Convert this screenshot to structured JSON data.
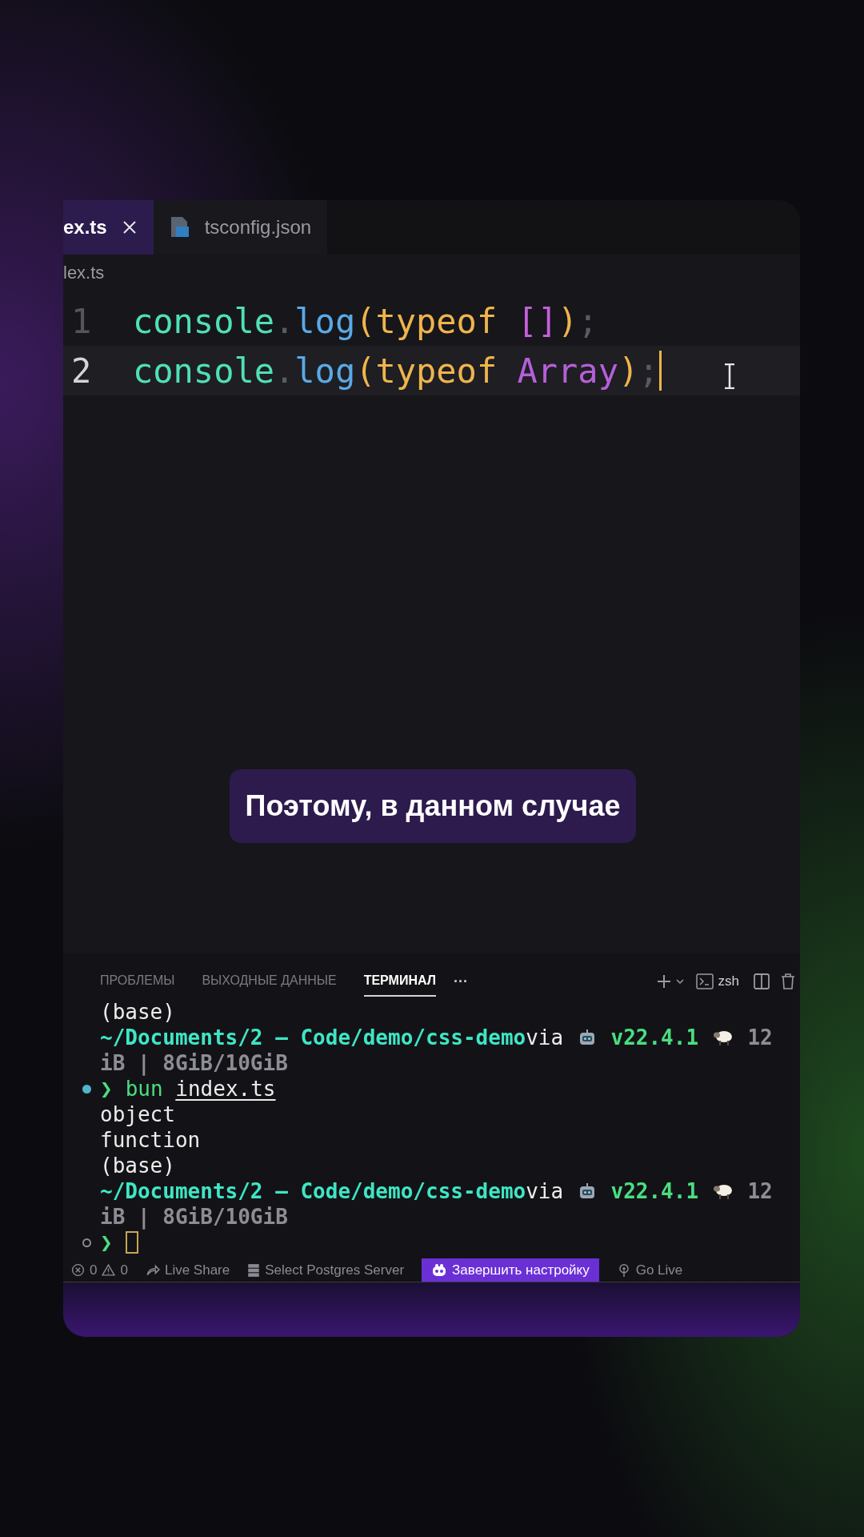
{
  "tabs": [
    {
      "label": "ex.ts",
      "selected": true,
      "closable": true
    },
    {
      "label": "tsconfig.json",
      "selected": false,
      "closable": false
    }
  ],
  "breadcrumb": "lex.ts",
  "code_lines": [
    {
      "number": "1",
      "current": false,
      "tokens": [
        {
          "text": "console",
          "color": "#4fe0b6"
        },
        {
          "text": ".",
          "color": "#5a5a66"
        },
        {
          "text": "log",
          "color": "#5aa9e6"
        },
        {
          "text": "(",
          "color": "#f0b44c"
        },
        {
          "text": "typeof ",
          "color": "#f0b44c"
        },
        {
          "text": "[]",
          "color": "#c55fd9"
        },
        {
          "text": ")",
          "color": "#f0b44c"
        },
        {
          "text": ";",
          "color": "#5a5a66"
        }
      ]
    },
    {
      "number": "2",
      "current": true,
      "tokens": [
        {
          "text": "console",
          "color": "#4fe0b6"
        },
        {
          "text": ".",
          "color": "#5a5a66"
        },
        {
          "text": "log",
          "color": "#5aa9e6"
        },
        {
          "text": "(",
          "color": "#f0b44c"
        },
        {
          "text": "typeof ",
          "color": "#f0b44c"
        },
        {
          "text": "Array",
          "color": "#b65fd9"
        },
        {
          "text": ")",
          "color": "#f0b44c"
        },
        {
          "text": ";",
          "color": "#5a5a66"
        }
      ]
    }
  ],
  "caption": "Поэтому, в данном случае",
  "panel_tabs": [
    {
      "label": "ПРОБЛЕМЫ",
      "selected": false
    },
    {
      "label": "ВЫХОДНЫЕ ДАННЫЕ",
      "selected": false
    },
    {
      "label": "ТЕРМИНАЛ",
      "selected": true
    }
  ],
  "panel_more": "···",
  "shell": "zsh",
  "terminal_lines": [
    {
      "segments": [
        {
          "kind": "plain",
          "text": "(base)"
        }
      ]
    },
    {
      "segments": [
        {
          "kind": "path",
          "text": "~/Documents/2 – Code/demo/css-demo"
        },
        {
          "kind": "plain",
          "text": "via "
        },
        {
          "kind": "robot"
        },
        {
          "kind": "version",
          "text": " v22.4.1 "
        },
        {
          "kind": "sheep"
        },
        {
          "kind": "dim",
          "text": " 12"
        }
      ]
    },
    {
      "segments": [
        {
          "kind": "dim",
          "text": "iB | 8GiB/10GiB"
        }
      ]
    },
    {
      "prompt": {
        "filled": true,
        "symbol": "❯"
      },
      "segments": [
        {
          "kind": "cmd",
          "text": "bun "
        },
        {
          "kind": "arg",
          "text": "index.ts"
        }
      ]
    },
    {
      "segments": [
        {
          "kind": "plain",
          "text": "object"
        }
      ]
    },
    {
      "segments": [
        {
          "kind": "plain",
          "text": "function"
        }
      ]
    },
    {
      "segments": [
        {
          "kind": "plain",
          "text": "(base)"
        }
      ]
    },
    {
      "segments": [
        {
          "kind": "path",
          "text": "~/Documents/2 – Code/demo/css-demo"
        },
        {
          "kind": "plain",
          "text": "via "
        },
        {
          "kind": "robot"
        },
        {
          "kind": "version",
          "text": " v22.4.1 "
        },
        {
          "kind": "sheep"
        },
        {
          "kind": "dim",
          "text": " 12"
        }
      ]
    },
    {
      "segments": [
        {
          "kind": "dim",
          "text": "iB | 8GiB/10GiB"
        }
      ]
    },
    {
      "prompt": {
        "filled": false,
        "symbol": "❯"
      },
      "cursor": true
    }
  ],
  "status_bar": [
    {
      "kind": "errors",
      "errors": "0",
      "warnings": "0"
    },
    {
      "kind": "live-share",
      "text": "Live Share"
    },
    {
      "kind": "database",
      "text": "Select Postgres Server"
    },
    {
      "kind": "highlight",
      "text": "Завершить настройку"
    },
    {
      "kind": "broadcast",
      "text": "Go Live"
    }
  ]
}
